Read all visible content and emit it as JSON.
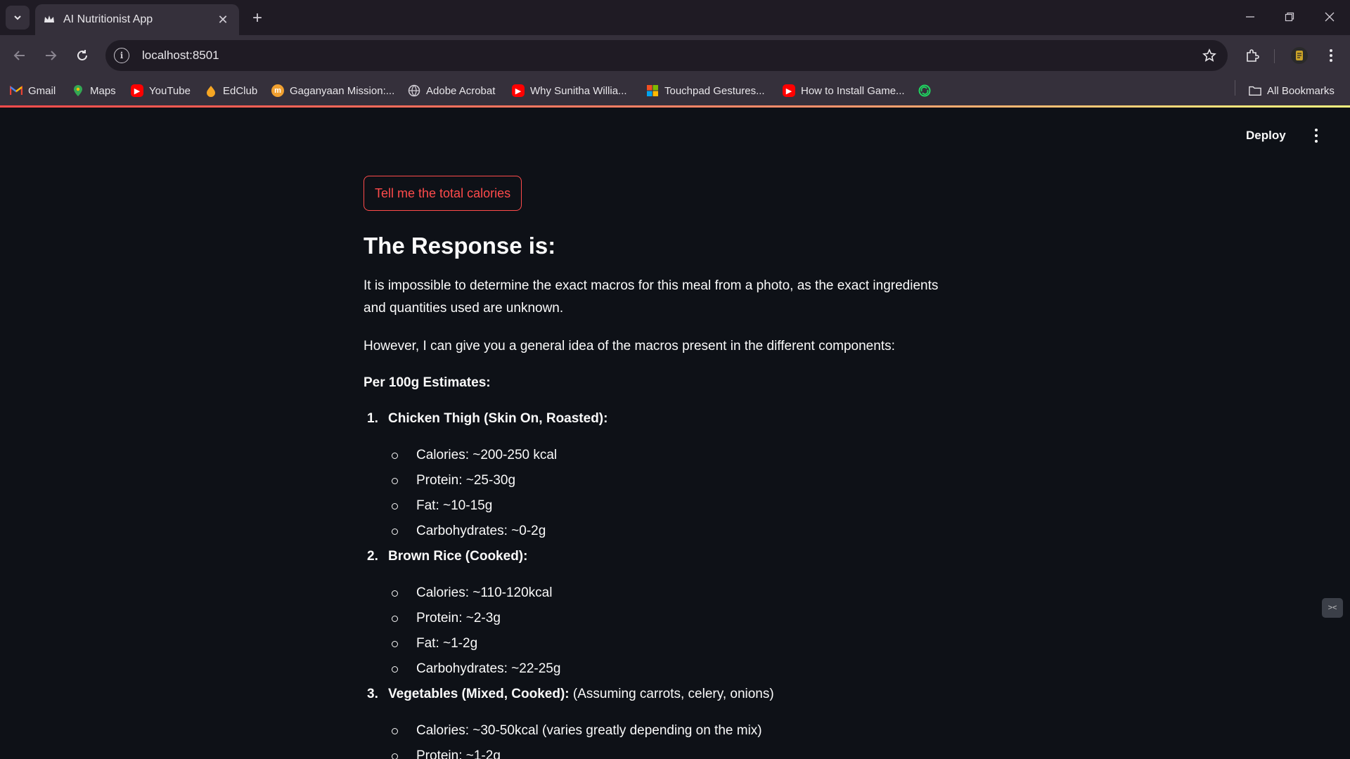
{
  "browser": {
    "tab_title": "AI Nutritionist App",
    "url": "localhost:8501",
    "bookmarks": [
      {
        "label": "Gmail",
        "icon": "gmail-icon"
      },
      {
        "label": "Maps",
        "icon": "maps-icon"
      },
      {
        "label": "YouTube",
        "icon": "youtube-icon"
      },
      {
        "label": "EdClub",
        "icon": "edclub-icon"
      },
      {
        "label": "Gaganyaan Mission:...",
        "icon": "gaganyaan-icon"
      },
      {
        "label": "Adobe Acrobat",
        "icon": "globe-icon"
      },
      {
        "label": "Why Sunitha Willia...",
        "icon": "youtube-icon"
      },
      {
        "label": "Touchpad Gestures...",
        "icon": "microsoft-icon"
      },
      {
        "label": "How to Install Game...",
        "icon": "youtube-icon"
      }
    ],
    "all_bookmarks": "All Bookmarks"
  },
  "app": {
    "deploy_label": "Deploy",
    "button_label": "Tell me the total calories",
    "heading": "The Response is:",
    "intro": "It is impossible to determine the exact macros for this meal from a photo, as the exact ingredients and quantities used are unknown.",
    "however": "However, I can give you a general idea of the macros present in the different components:",
    "estimates_title": "Per 100g Estimates:",
    "items": [
      {
        "num": "1.",
        "title": "Chicken Thigh (Skin On, Roasted):",
        "note": "",
        "facts": [
          "Calories: ~200-250 kcal",
          "Protein: ~25-30g",
          "Fat: ~10-15g",
          "Carbohydrates: ~0-2g"
        ]
      },
      {
        "num": "2.",
        "title": "Brown Rice (Cooked):",
        "note": "",
        "facts": [
          "Calories: ~110-120kcal",
          "Protein: ~2-3g",
          "Fat: ~1-2g",
          "Carbohydrates: ~22-25g"
        ]
      },
      {
        "num": "3.",
        "title": "Vegetables (Mixed, Cooked):",
        "note": " (Assuming carrots, celery, onions)",
        "facts": [
          "Calories: ~30-50kcal (varies greatly depending on the mix)",
          "Protein: ~1-2g"
        ]
      }
    ]
  },
  "colors": {
    "accent": "#ff4b4b",
    "background": "#0e1117",
    "chrome_dark": "#1f1b24",
    "chrome_mid": "#35303b"
  }
}
